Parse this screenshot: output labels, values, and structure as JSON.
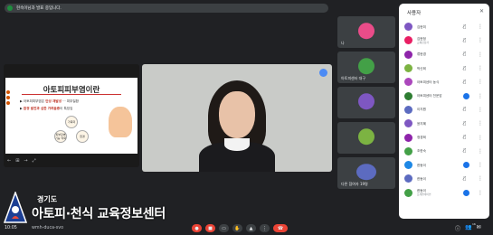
{
  "banner": {
    "text": "현속이님과 발표 중입니다."
  },
  "slide": {
    "title": "아토피피부염이란",
    "bullets": [
      {
        "prefix": "아토피피부염은",
        "highlight": "만성 재발성",
        "suffix": "··· 피부질환"
      },
      {
        "prefix": "",
        "highlight": "환경 발진과 심한 가려움증",
        "suffix": "이 특징임"
      }
    ],
    "circles": [
      "가족력",
      "피부장벽 기능 약화",
      "환경"
    ],
    "nav": [
      "←",
      "⊞",
      "→",
      "⤢"
    ]
  },
  "camera": {
    "name": ""
  },
  "grid": [
    {
      "name": "나",
      "color": "#ea4c89",
      "avatar": "avatar-icon"
    },
    {
      "name": "아토피센터 대구",
      "color": "#43a047",
      "avatar": "avatar-icon"
    },
    {
      "name": "",
      "color": "#7e57c2",
      "avatar": "avatar-icon"
    },
    {
      "name": "",
      "color": "#7cb342",
      "avatar": "avatar-icon"
    },
    {
      "name": "다른 참여자 19명",
      "color": "#5c6bc0",
      "avatar": "avatar-group-icon"
    }
  ],
  "panel": {
    "title": "사용자",
    "participants": [
      {
        "name": "김현미",
        "sub": "",
        "color": "#7e57c2",
        "mic": "off"
      },
      {
        "name": "김현정",
        "sub": "교육담당자",
        "color": "#e91e63",
        "mic": "off"
      },
      {
        "name": "류현경",
        "sub": "",
        "color": "#8e24aa",
        "mic": "off"
      },
      {
        "name": "박신희",
        "sub": "",
        "color": "#7cb342",
        "mic": "off"
      },
      {
        "name": "아토피센터 농식",
        "sub": "",
        "color": "#ab47bc",
        "mic": "off"
      },
      {
        "name": "아토피센터 천운암",
        "sub": "",
        "color": "#2e7d32",
        "mic": "on"
      },
      {
        "name": "이지원",
        "sub": "",
        "color": "#5c6bc0",
        "mic": "off"
      },
      {
        "name": "윤지혜",
        "sub": "",
        "color": "#7e57c2",
        "mic": "off"
      },
      {
        "name": "정경희",
        "sub": "",
        "color": "#8e24aa",
        "mic": "off"
      },
      {
        "name": "조한숙",
        "sub": "",
        "color": "#43a047",
        "mic": "off"
      },
      {
        "name": "한동이",
        "sub": "",
        "color": "#1e88e5",
        "mic": "on"
      },
      {
        "name": "한동이",
        "sub": "",
        "color": "#5c6bc0",
        "mic": "off"
      },
      {
        "name": "한동이",
        "sub": "프레젠테이션",
        "color": "#43a047",
        "mic": "on"
      }
    ]
  },
  "logo": {
    "small": "경기도",
    "big": "아토피·천식 교육정보센터"
  },
  "bottombar": {
    "time": "10:05",
    "code": "wmh-duca-svo",
    "controls": [
      "mic-off-icon",
      "camera-icon",
      "captions-icon",
      "hand-icon",
      "present-icon",
      "more-icon",
      "end-call-icon"
    ],
    "participant_count": "16"
  },
  "colors": {
    "background": "#202124",
    "accent": "#1a73e8",
    "danger": "#ea4335"
  }
}
